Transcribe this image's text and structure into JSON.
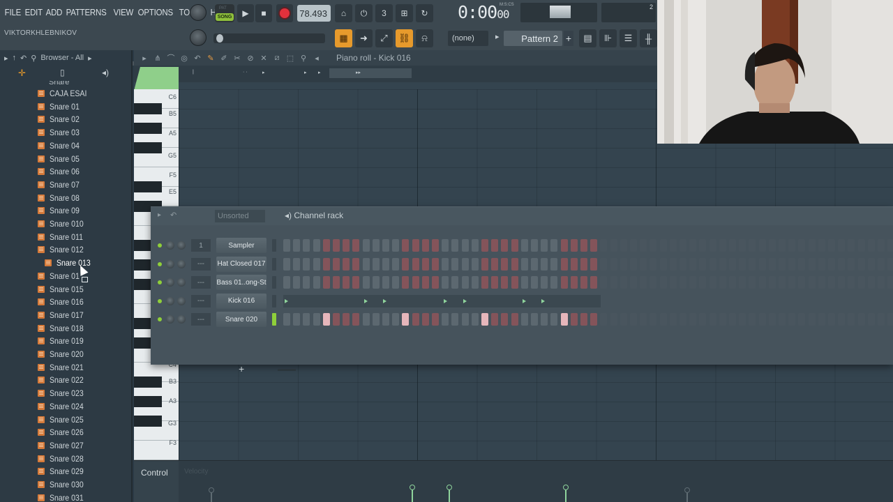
{
  "menu": [
    "FILE",
    "EDIT",
    "ADD",
    "PATTERNS",
    "VIEW",
    "OPTIONS",
    "TOOLS",
    "HELP"
  ],
  "user": "VIKTORKHLEBNIKOV",
  "transport": {
    "mode_top": "PAT",
    "mode_active": "SONG",
    "tempo": "78.493",
    "time": "0:00",
    "time_small": "00",
    "time_unit": "M:S:CS",
    "monitor_value": "2"
  },
  "pattern": {
    "selector": "(none)",
    "name": "Pattern 2"
  },
  "browser": {
    "title": "Browser - All",
    "folder_above": "Snare",
    "items": [
      "CAJA ESAI",
      "Snare 01",
      "Snare 02",
      "Snare 03",
      "Snare 04",
      "Snare 05",
      "Snare 06",
      "Snare 07",
      "Snare 08",
      "Snare 09",
      "Snare 010",
      "Snare 011",
      "Snare 012",
      "Snare 013",
      "Snare 01",
      "Snare 015",
      "Snare 016",
      "Snare 017",
      "Snare 018",
      "Snare 019",
      "Snare 020",
      "Snare 021",
      "Snare 022",
      "Snare 023",
      "Snare 024",
      "Snare 025",
      "Snare 026",
      "Snare 027",
      "Snare 028",
      "Snare 029",
      "Snare 030",
      "Snare 031"
    ],
    "selected_index": 13
  },
  "piano_roll": {
    "title": "Piano roll - Kick 016",
    "keys_top": [
      "C6",
      "B5",
      "A5",
      "G5",
      "F5",
      "E5"
    ],
    "keys_bottom": [
      "C4",
      "B3",
      "A3",
      "G3",
      "F3"
    ]
  },
  "control": {
    "label": "Control",
    "hint": "Velocity"
  },
  "channel_rack": {
    "title": "Channel rack",
    "filter": "Unsorted",
    "add": "+",
    "channels": [
      {
        "name": "Sampler",
        "route": "1",
        "active": []
      },
      {
        "name": "Hat Closed 017",
        "route": "---",
        "active": []
      },
      {
        "name": "Bass 01..ong-St",
        "route": "---",
        "active": []
      },
      {
        "name": "Kick 016",
        "route": "---",
        "piano_roll": true
      },
      {
        "name": "Snare 020",
        "route": "---",
        "active": [
          4,
          12,
          20,
          28
        ],
        "selected": true
      }
    ]
  },
  "colors": {
    "accent_green": "#8fcf3a",
    "accent_orange": "#e79a2c",
    "record_red": "#e2313c"
  }
}
